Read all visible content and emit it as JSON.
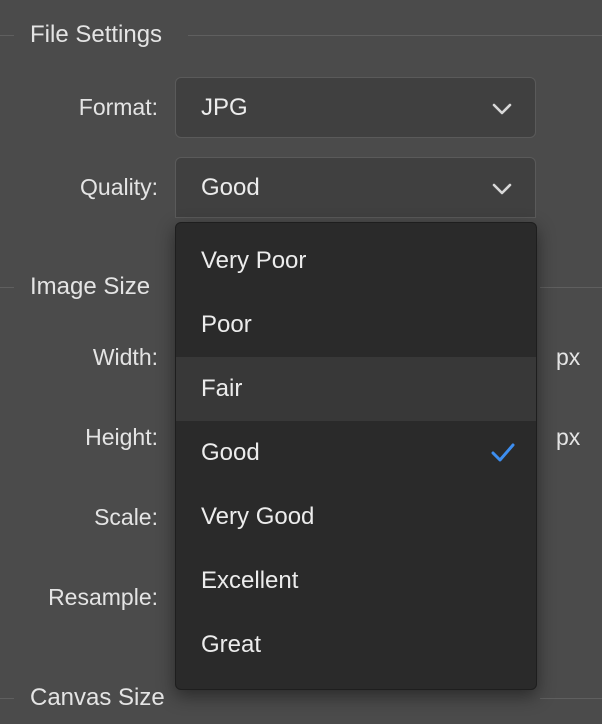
{
  "sections": {
    "file_settings": "File Settings",
    "image_size": "Image Size",
    "canvas_size": "Canvas Size"
  },
  "format": {
    "label": "Format:",
    "value": "JPG"
  },
  "quality": {
    "label": "Quality:",
    "value": "Good",
    "options": [
      "Very Poor",
      "Poor",
      "Fair",
      "Good",
      "Very Good",
      "Excellent",
      "Great"
    ],
    "selected": "Good",
    "hovered": "Fair"
  },
  "image_size": {
    "width_label": "Width:",
    "width_unit": "px",
    "height_label": "Height:",
    "height_unit": "px",
    "scale_label": "Scale:",
    "resample_label": "Resample:"
  },
  "icons": {
    "chevron": "chevron-down-icon",
    "check": "checkmark-icon"
  },
  "colors": {
    "background": "#4b4b4b",
    "menu": "#2a2a2a",
    "hover": "#383838",
    "accent": "#3d8ef0"
  }
}
